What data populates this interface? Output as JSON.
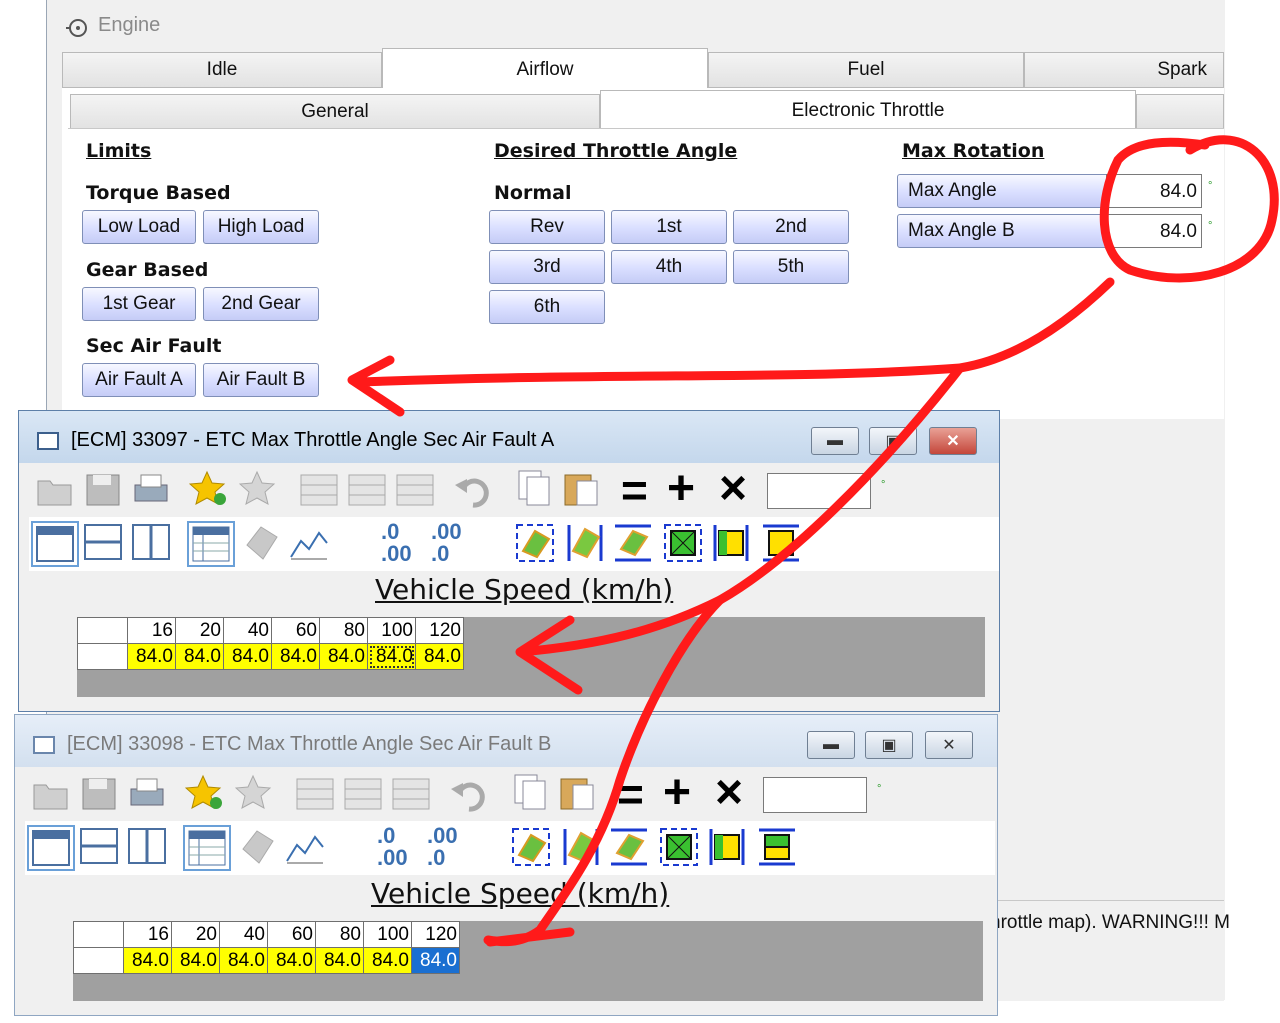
{
  "engine": {
    "title": "Engine",
    "tabs": [
      "Idle",
      "Airflow",
      "Fuel",
      "Spark"
    ],
    "active_tab": "Airflow",
    "subtabs": [
      "General",
      "Electronic Throttle"
    ],
    "active_subtab": "Electronic Throttle"
  },
  "limits": {
    "header": "Limits",
    "torque_based": "Torque Based",
    "torque_buttons": [
      "Low Load",
      "High Load"
    ],
    "gear_based": "Gear Based",
    "gear_buttons": [
      "1st Gear",
      "2nd Gear"
    ],
    "sec_air_fault": "Sec Air Fault",
    "air_fault_buttons": [
      "Air Fault A",
      "Air Fault B"
    ]
  },
  "desired": {
    "header": "Desired Throttle Angle",
    "normal": "Normal",
    "buttons": [
      "Rev",
      "1st",
      "2nd",
      "3rd",
      "4th",
      "5th",
      "6th"
    ]
  },
  "max_rotation": {
    "header": "Max Rotation",
    "rows": [
      {
        "label": "Max Angle",
        "value": "84.0",
        "unit": "°"
      },
      {
        "label": "Max Angle B",
        "value": "84.0",
        "unit": "°"
      }
    ]
  },
  "window_a": {
    "title": "[ECM] 33097 - ETC Max Throttle Angle Sec Air Fault A",
    "axis_label": "Vehicle Speed (km/h)",
    "unit": "°",
    "columns": [
      "16",
      "20",
      "40",
      "60",
      "80",
      "100",
      "120"
    ],
    "values": [
      "84.0",
      "84.0",
      "84.0",
      "84.0",
      "84.0",
      "84.0",
      "84.0"
    ],
    "focused_index": 5
  },
  "window_b": {
    "title": "[ECM] 33098 - ETC Max Throttle Angle Sec Air Fault B",
    "axis_label": "Vehicle Speed (km/h)",
    "unit": "°",
    "columns": [
      "16",
      "20",
      "40",
      "60",
      "80",
      "100",
      "120"
    ],
    "values": [
      "84.0",
      "84.0",
      "84.0",
      "84.0",
      "84.0",
      "84.0",
      "84.0"
    ],
    "selected_index": 6
  },
  "toolbar_symbols": {
    "equals": "=",
    "plus": "+",
    "times": "×",
    "dec_more": ".0",
    "dec_more2": ".00",
    "dec_less": ".00",
    "dec_less2": ".0"
  },
  "status_text": "hrottle map). WARNING!!! M",
  "annotation_color": "#ff1a1a"
}
